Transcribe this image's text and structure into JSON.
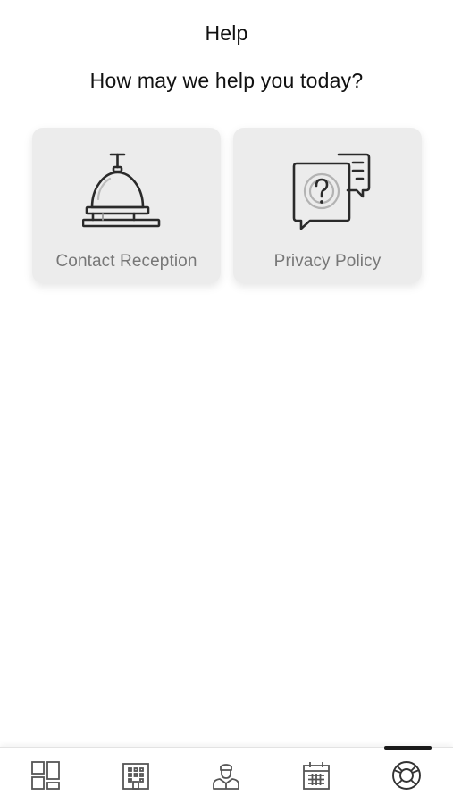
{
  "header": {
    "title": "Help",
    "subtitle": "How may we help you today?"
  },
  "cards": [
    {
      "label": "Contact Reception",
      "icon": "reception-bell-icon"
    },
    {
      "label": "Privacy Policy",
      "icon": "privacy-policy-chat-icon"
    }
  ],
  "tab_bar": {
    "items": [
      {
        "icon": "dashboard-icon"
      },
      {
        "icon": "hotel-building-icon"
      },
      {
        "icon": "concierge-icon"
      },
      {
        "icon": "calendar-icon"
      },
      {
        "icon": "lifebuoy-help-icon",
        "active": true
      }
    ]
  },
  "colors": {
    "card_background": "#ececec",
    "label_text": "#777777",
    "icon_stroke": "#2a2a2a",
    "active_indicator": "#1a1a1a"
  }
}
